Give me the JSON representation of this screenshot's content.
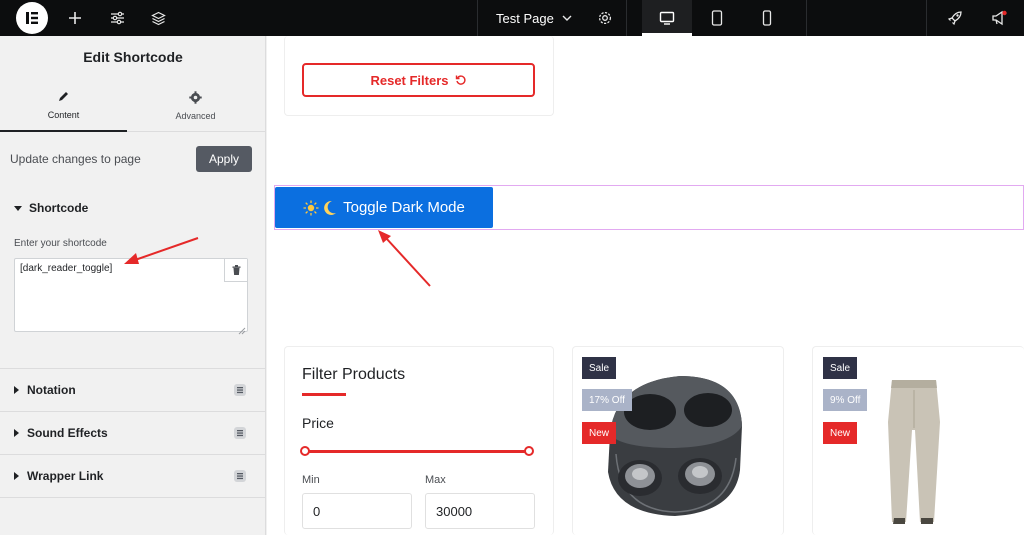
{
  "topbar": {
    "page_title": "Test Page"
  },
  "sidebar": {
    "title": "Edit Shortcode",
    "tabs": [
      {
        "label": "Content",
        "icon": "pencil-icon"
      },
      {
        "label": "Advanced",
        "icon": "gear-icon"
      }
    ],
    "update_text": "Update changes to page",
    "apply_label": "Apply",
    "shortcode_section": "Shortcode",
    "shortcode_field_label": "Enter your shortcode",
    "shortcode_value": "[dark_reader_toggle]",
    "collapsed_sections": [
      "Notation",
      "Sound Effects",
      "Wrapper Link"
    ]
  },
  "canvas": {
    "reset_filters_label": "Reset Filters",
    "dark_mode_button_label": "Toggle Dark Mode",
    "filter": {
      "title": "Filter Products",
      "price_label": "Price",
      "min_label": "Min",
      "max_label": "Max",
      "min_value": "0",
      "max_value": "30000"
    },
    "products": [
      {
        "sale": "Sale",
        "discount": "17% Off",
        "new": "New",
        "image": "wireless-earbuds-image"
      },
      {
        "sale": "Sale",
        "discount": "9% Off",
        "new": "New",
        "image": "trousers-image"
      }
    ]
  },
  "colors": {
    "accent_red": "#e52929",
    "button_blue": "#0b6fe0",
    "topbar": "#0c0d0e"
  }
}
